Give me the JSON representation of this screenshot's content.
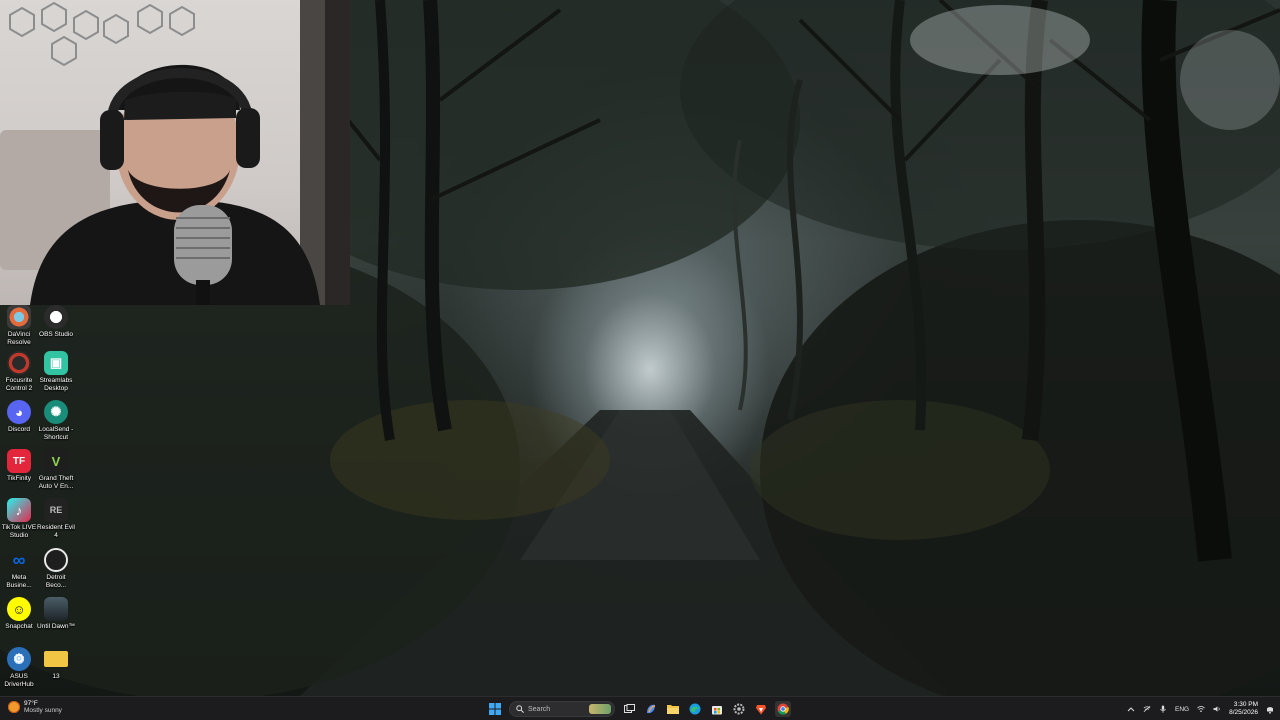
{
  "desktop": {
    "icons": [
      {
        "label": "DaVinci Resolve",
        "icon": "davinci-resolve-icon",
        "color": "#3b3b3b"
      },
      {
        "label": "OBS Studio",
        "icon": "obs-studio-icon",
        "color": "#2b2b2b"
      },
      {
        "label": "Focusrite Control 2",
        "icon": "focusrite-icon",
        "color": "#c0392b"
      },
      {
        "label": "Streamlabs Desktop",
        "icon": "streamlabs-icon",
        "color": "#31c3a2"
      },
      {
        "label": "Discord",
        "icon": "discord-icon",
        "color": "#5865f2"
      },
      {
        "label": "LocalSend - Shortcut",
        "icon": "localsend-icon",
        "color": "#1a8d7a"
      },
      {
        "label": "TikFinity",
        "icon": "tikfinity-icon",
        "color": "#e3263b"
      },
      {
        "label": "Grand Theft Auto V En...",
        "icon": "gta-v-icon",
        "color": "#1e1e1e"
      },
      {
        "label": "TikTok LIVE Studio",
        "icon": "tiktok-live-icon",
        "color": "#e8264d"
      },
      {
        "label": "Resident Evil 4",
        "icon": "resident-evil-icon",
        "color": "#222222"
      },
      {
        "label": "Meta Busine...",
        "icon": "meta-business-icon",
        "color": "#0668e1"
      },
      {
        "label": "Detroit Beco...",
        "icon": "detroit-icon",
        "color": "#e8e8e8"
      },
      {
        "label": "Snapchat",
        "icon": "snapchat-icon",
        "color": "#fffc00"
      },
      {
        "label": "Until Dawn™",
        "icon": "until-dawn-icon",
        "color": "#2a3a44"
      },
      {
        "label": "ASUS DriverHub",
        "icon": "asus-driverhub-icon",
        "color": "#2a6fb8"
      },
      {
        "label": "13",
        "icon": "folder-icon",
        "color": "#f2c545"
      }
    ]
  },
  "taskbar": {
    "weather": {
      "temp": "97°F",
      "condition": "Mostly sunny"
    },
    "search_placeholder": "Search",
    "pinned": [
      "start-icon",
      "search",
      "task-view-icon",
      "copilot-icon",
      "file-explorer-icon",
      "edge-icon",
      "store-icon",
      "settings-icon",
      "brave-icon",
      "chrome-icon"
    ],
    "tray": {
      "language": "ENG",
      "time": "3:30 PM",
      "date": "8/25/2026"
    }
  },
  "colors": {
    "taskbar_bg": "#1c1c1e",
    "windows_blue": "#0a84ff"
  }
}
